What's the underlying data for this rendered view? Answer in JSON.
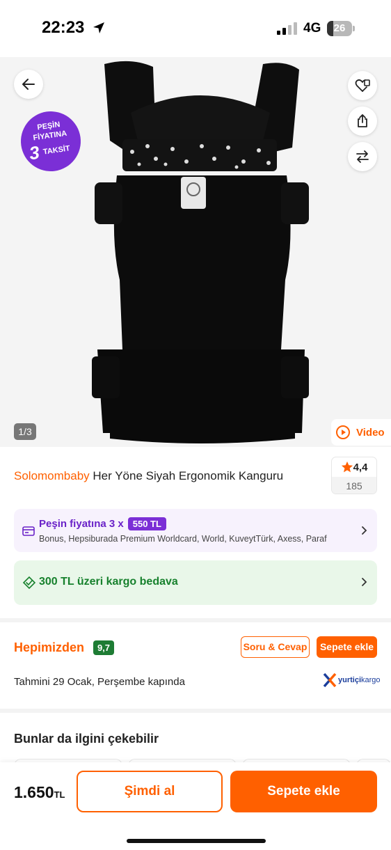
{
  "status_bar": {
    "time": "22:23",
    "network": "4G",
    "battery": "26",
    "battery_level": 0.26
  },
  "gallery": {
    "promo": {
      "line1": "PEŞİN",
      "line2": "FİYATINA",
      "number": "3",
      "line3": "TAKSİT"
    },
    "page_indicator": "1/3",
    "video_label": "Video"
  },
  "product": {
    "brand": "Solomombaby",
    "name": "Her Yöne Siyah Ergonomik Kanguru",
    "rating": "4,4",
    "review_count": "185"
  },
  "installment": {
    "prefix": "Peşin fiyatına 3 x",
    "price": "550 TL",
    "banks": "Bonus, Hepsiburada Premium Worldcard, World, KuveytTürk, Axess, Paraf"
  },
  "shipping": {
    "text": "300 TL üzeri kargo bedava"
  },
  "seller": {
    "name": "Hepimizden",
    "score": "9,7",
    "qa_label": "Soru & Cevap",
    "add_to_cart_label": "Sepete ekle",
    "delivery_text": "Tahmini 29 Ocak, Perşembe kapında",
    "cargo_brand": "yurtiçi",
    "cargo_suffix": "kargo"
  },
  "recommendations": {
    "title": "Bunlar da ilgini çekebilir"
  },
  "bottom_bar": {
    "price": "1.650",
    "currency": "TL",
    "buy_now_label": "Şimdi al",
    "add_to_cart_label": "Sepete ekle"
  },
  "colors": {
    "accent": "#ff6000",
    "promo_purple": "#7b2fd6",
    "shipping_green": "#17812d",
    "seller_score_green": "#1e7c34"
  },
  "icons": [
    "location-arrow-icon",
    "signal-icon",
    "back-arrow-icon",
    "heart-add-icon",
    "share-icon",
    "compare-arrows-icon",
    "play-icon",
    "star-icon",
    "card-icon",
    "chevron-right-icon",
    "shipping-icon",
    "yurtici-kargo-logo"
  ]
}
